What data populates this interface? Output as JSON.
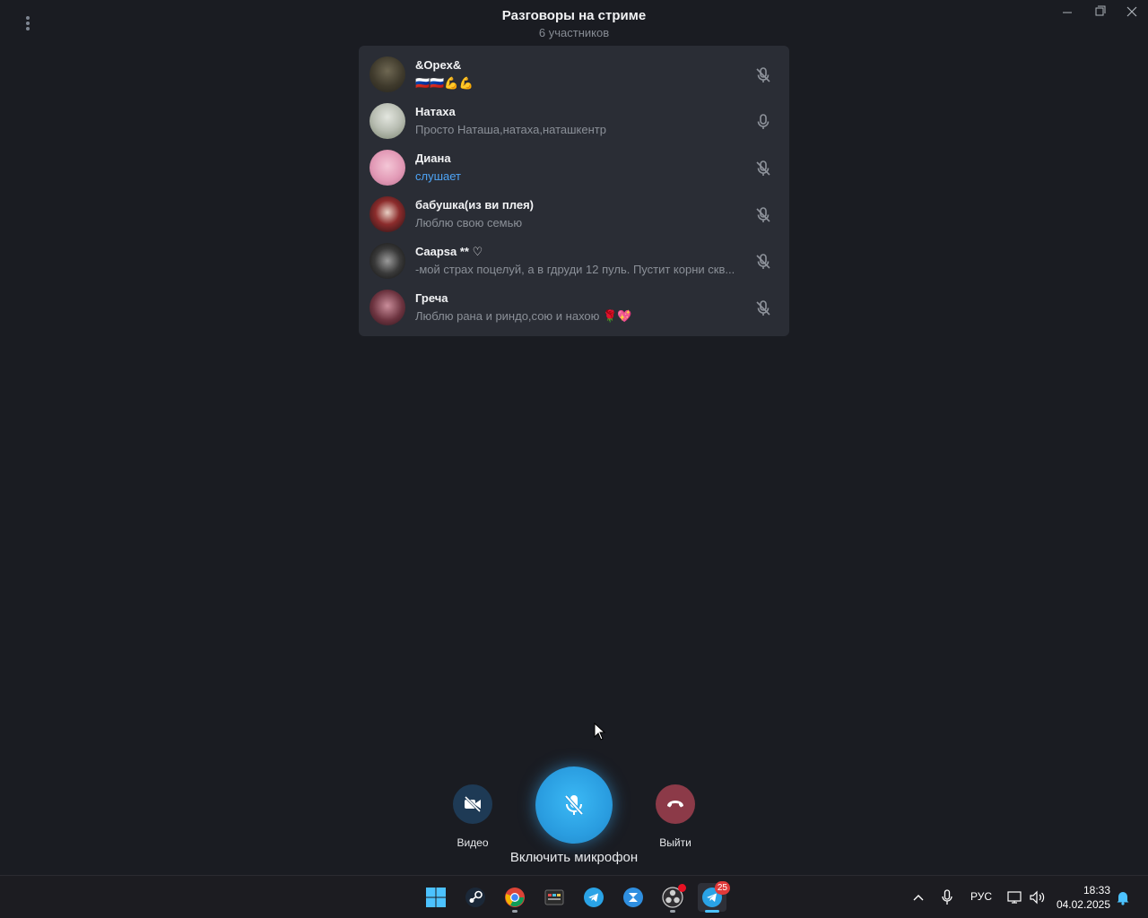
{
  "window": {
    "title": "Разговоры на стриме",
    "subtitle": "6 участников"
  },
  "participants": [
    {
      "name": "&Opex&",
      "status": "🇷🇺🇷🇺💪💪",
      "mic_state": "muted",
      "status_style": "emoji"
    },
    {
      "name": "Натаха",
      "status": "Просто Наташа,натаха,наташкентр",
      "mic_state": "unmuted",
      "status_style": "normal"
    },
    {
      "name": "Диана",
      "status": "слушает",
      "mic_state": "muted",
      "status_style": "listening"
    },
    {
      "name": "бабушка(из ви плея)",
      "status": "Люблю свою семью",
      "mic_state": "muted",
      "status_style": "normal"
    },
    {
      "name": "Caapsa ** ♡",
      "status": "-мой страх поцелуй, а в гдруди 12 пуль. Пустит корни скв...",
      "mic_state": "muted",
      "status_style": "normal"
    },
    {
      "name": "Греча",
      "status": "Люблю рана и риндо,сою и нахою 🌹💖",
      "mic_state": "muted",
      "status_style": "normal"
    }
  ],
  "controls": {
    "video_label": "Видео",
    "mic_label": "Включить микрофон",
    "leave_label": "Выйти"
  },
  "taskbar": {
    "apps": [
      "windows-start",
      "steam",
      "chrome",
      "media-app",
      "telegram",
      "app-x",
      "obs",
      "telegram-active"
    ],
    "telegram_badge": "25",
    "lang": "РУС",
    "time": "18:33",
    "date": "04.02.2025"
  },
  "colors": {
    "background": "#1a1c22",
    "panel": "#2a2d35",
    "accent": "#4ea4f6",
    "mic_button": "#2aa3e6",
    "leave_button": "#8c3a48"
  }
}
